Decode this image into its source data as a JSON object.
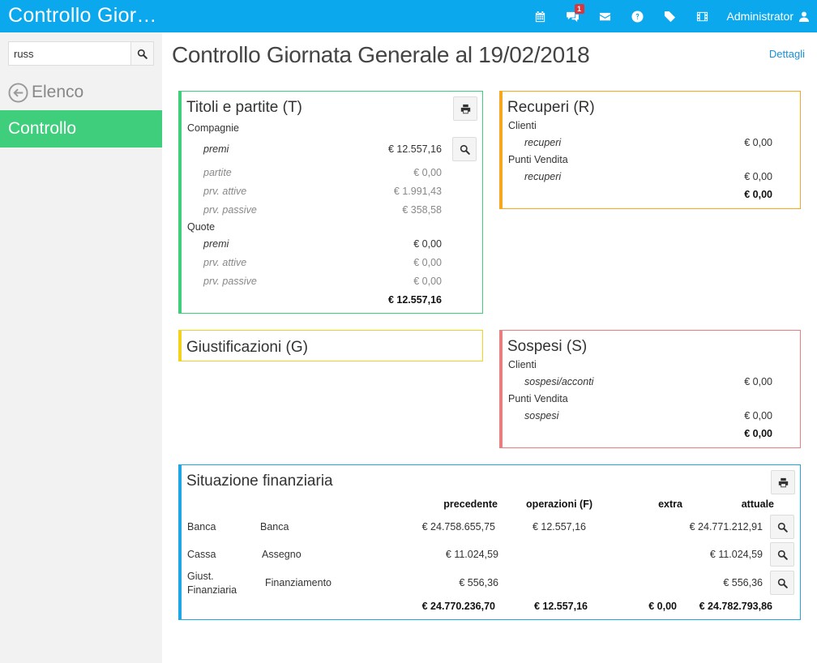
{
  "app": {
    "title": "Controllo Gior…",
    "user_label": "Administrator",
    "notifications_count": "1",
    "accent_color": "#0ca8ee"
  },
  "sidebar": {
    "search_value": "russ",
    "back_label": "Elenco",
    "active_label": "Controllo"
  },
  "page": {
    "title": "Controllo Giornata Generale al 19/02/2018",
    "details_link": "Dettagli"
  },
  "titoli": {
    "title": "Titoli e partite (T)",
    "group1": "Compagnie",
    "g1": [
      {
        "label": "premi",
        "value": "€ 12.557,16"
      },
      {
        "label": "partite",
        "value": "€ 0,00"
      },
      {
        "label": "prv. attive",
        "value": "€ 1.991,43"
      },
      {
        "label": "prv. passive",
        "value": "€ 358,58"
      }
    ],
    "group2": "Quote",
    "g2": [
      {
        "label": "premi",
        "value": "€ 0,00"
      },
      {
        "label": "prv. attive",
        "value": "€ 0,00"
      },
      {
        "label": "prv. passive",
        "value": "€ 0,00"
      }
    ],
    "total": "€ 12.557,16"
  },
  "recuperi": {
    "title": "Recuperi (R)",
    "group1": "Clienti",
    "g1_label": "recuperi",
    "g1_value": "€ 0,00",
    "group2": "Punti Vendita",
    "g2_label": "recuperi",
    "g2_value": "€ 0,00",
    "total": "€ 0,00"
  },
  "giustificazioni": {
    "title": "Giustificazioni (G)"
  },
  "sospesi": {
    "title": "Sospesi (S)",
    "group1": "Clienti",
    "g1_label": "sospesi/acconti",
    "g1_value": "€ 0,00",
    "group2": "Punti Vendita",
    "g2_label": "sospesi",
    "g2_value": "€ 0,00",
    "total": "€ 0,00"
  },
  "finanziaria": {
    "title": "Situazione finanziaria",
    "headers": {
      "precedente": "precedente",
      "operazioni": "operazioni (F)",
      "extra": "extra",
      "attuale": "attuale"
    },
    "rows": [
      {
        "type": "Banca",
        "name": "Banca",
        "precedente": "€ 24.758.655,75",
        "operazioni": "€ 12.557,16",
        "extra": "",
        "attuale": "€ 24.771.212,91"
      },
      {
        "type": "Cassa",
        "name": "Assegno",
        "precedente": "€ 11.024,59",
        "operazioni": "",
        "extra": "",
        "attuale": "€ 11.024,59"
      },
      {
        "type_line1": "Giust.",
        "type_line2": "Finanziaria",
        "name": "Finanziamento",
        "precedente": "€ 556,36",
        "operazioni": "",
        "extra": "",
        "attuale": "€ 556,36"
      }
    ],
    "totals": {
      "precedente": "€ 24.770.236,70",
      "operazioni": "€ 12.557,16",
      "extra": "€ 0,00",
      "attuale": "€ 24.782.793,86"
    }
  }
}
